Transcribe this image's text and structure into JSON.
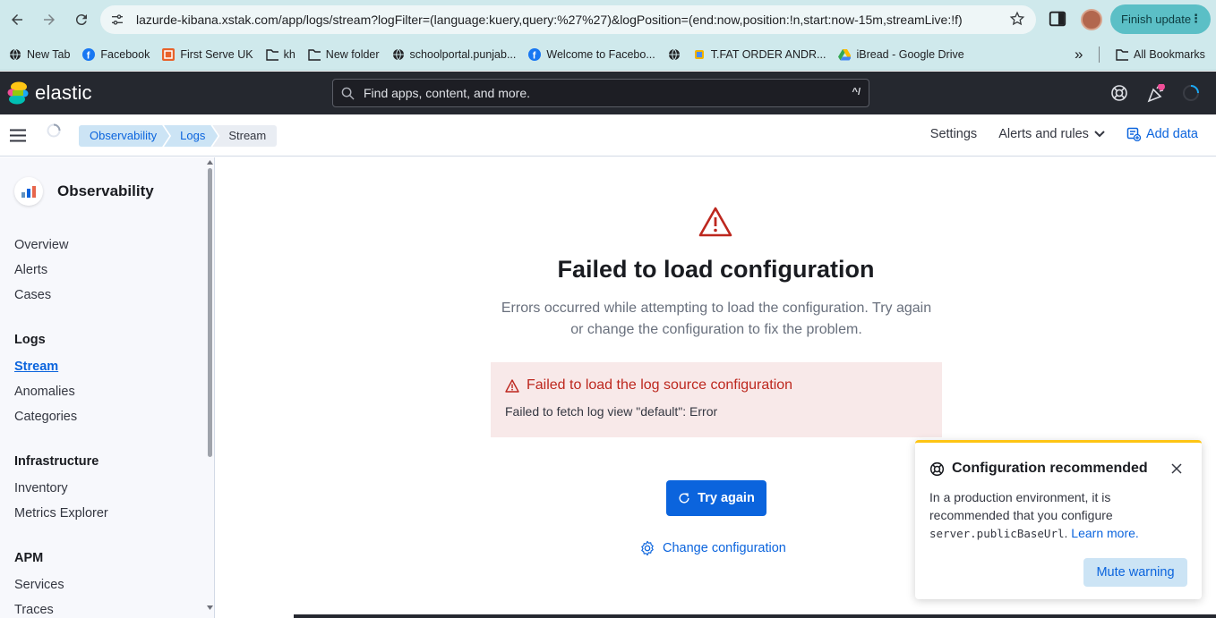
{
  "browser": {
    "url": "lazurde-kibana.xstak.com/app/logs/stream?logFilter=(language:kuery,query:%27%27)&logPosition=(end:now,position:!n,start:now-15m,streamLive:!f)",
    "finish_update_label": "Finish update",
    "bookmarks": [
      {
        "label": "New Tab",
        "icon": "globe-icon"
      },
      {
        "label": "Facebook",
        "icon": "facebook-icon"
      },
      {
        "label": "First Serve UK",
        "icon": "app-icon"
      },
      {
        "label": "kh",
        "icon": "folder-icon"
      },
      {
        "label": "New folder",
        "icon": "folder-icon"
      },
      {
        "label": "schoolportal.punjab...",
        "icon": "globe-icon"
      },
      {
        "label": "Welcome to Facebo...",
        "icon": "facebook-icon"
      },
      {
        "label": "",
        "icon": "globe-icon"
      },
      {
        "label": "T.FAT ORDER ANDR...",
        "icon": "app-icon"
      },
      {
        "label": "iBread - Google Drive",
        "icon": "drive-icon"
      }
    ],
    "more_bookmarks": "»",
    "all_bookmarks_label": "All Bookmarks"
  },
  "header": {
    "logo_text": "elastic",
    "search_placeholder": "Find apps, content, and more.",
    "search_shortcut": "^/"
  },
  "subheader": {
    "breadcrumbs": [
      "Observability",
      "Logs",
      "Stream"
    ],
    "settings_label": "Settings",
    "alerts_label": "Alerts and rules",
    "add_data_label": "Add data"
  },
  "sidebar": {
    "title": "Observability",
    "items": {
      "overview": "Overview",
      "alerts": "Alerts",
      "cases": "Cases",
      "logs_group": "Logs",
      "stream": "Stream",
      "anomalies": "Anomalies",
      "categories": "Categories",
      "infra_group": "Infrastructure",
      "inventory": "Inventory",
      "metrics": "Metrics Explorer",
      "apm_group": "APM",
      "services": "Services",
      "traces": "Traces"
    }
  },
  "main": {
    "title": "Failed to load configuration",
    "description": "Errors occurred while attempting to load the configuration. Try again or change the configuration to fix the problem.",
    "callout_title": "Failed to load the log source configuration",
    "callout_body": "Failed to fetch log view \"default\": Error",
    "try_again_label": "Try again",
    "change_config_label": "Change configuration"
  },
  "toast": {
    "title": "Configuration recommended",
    "body_prefix": "In a production environment, it is recommended that you configure",
    "body_code": "server.publicBaseUrl",
    "body_suffix": ".",
    "learn_more": "Learn more.",
    "mute_label": "Mute warning"
  },
  "colors": {
    "accent": "#0b64dd",
    "danger": "#bd271e",
    "warning": "#fec514",
    "header_bg": "#25282f"
  }
}
